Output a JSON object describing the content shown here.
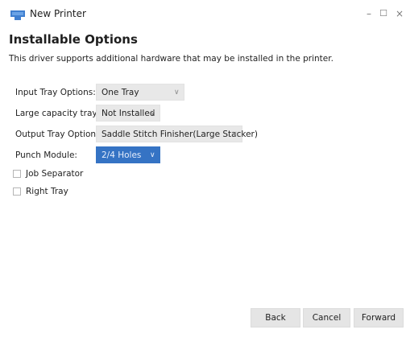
{
  "window": {
    "title": "New Printer",
    "min_glyph": "–",
    "max_glyph": "☐",
    "close_glyph": "×"
  },
  "page": {
    "heading": "Installable Options",
    "description": "This driver supports additional hardware that may be installed in the printer."
  },
  "options": [
    {
      "label": "Input Tray Options:",
      "value": "One Tray"
    },
    {
      "label": "Large capacity tray:",
      "value": "Not Installed"
    },
    {
      "label": "Output Tray Options:",
      "value": "Saddle Stitch Finisher(Large Stacker)"
    },
    {
      "label": "Punch Module:",
      "value": "2/4 Holes"
    }
  ],
  "checkboxes": [
    {
      "label": "Job Separator",
      "checked": false
    },
    {
      "label": "Right Tray",
      "checked": false
    }
  ],
  "buttons": {
    "back": "Back",
    "cancel": "Cancel",
    "forward": "Forward"
  },
  "colors": {
    "selected_combo": "#3573c4",
    "app_icon": "#3f7fd0"
  },
  "icons": {
    "combo_arrow": "chevron-down-icon",
    "arrow_glyph": "∨"
  }
}
